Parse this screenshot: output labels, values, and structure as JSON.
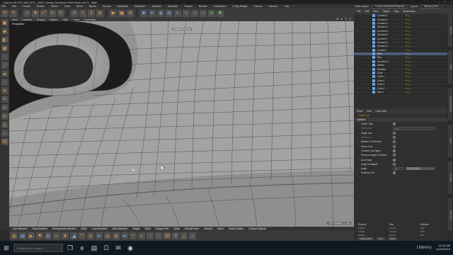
{
  "window": {
    "title": "Cinema 4D R21.026 (RC) - [2001 Harley-Davidson Street Bob.c4d *] - Main",
    "controls": [
      "–",
      "□",
      "×"
    ]
  },
  "menubar": [
    "File",
    "Edit",
    "Create",
    "Modes",
    "Select",
    "Tools",
    "Mesh",
    "Spline",
    "Volume",
    "MoGraph",
    "Character",
    "Animate",
    "Simulate",
    "Tracker",
    "Render",
    "Extensions",
    "X-Ray Bridge",
    "Corona",
    "Window",
    "Help"
  ],
  "layout": {
    "label": "Node Space:",
    "value": "Current (Standard/Physical)",
    "layout_label": "Layout:",
    "layout_value": "Startup (User)"
  },
  "toolbar_icons": [
    "undo-icon",
    "redo-icon",
    "live-selection-icon",
    "move-icon",
    "scale-icon",
    "rotate-icon",
    "recent-tools-icon",
    "x-axis-icon",
    "y-axis-icon",
    "z-axis-icon",
    "coordinate-system-icon",
    "render-view-icon",
    "render-picture-viewer-icon",
    "render-settings-icon",
    "cube-icon",
    "pen-icon",
    "subdivision-icon",
    "array-icon",
    "boole-icon",
    "sweep-icon",
    "deformer-icon",
    "floor-icon",
    "camera-icon",
    "light-icon"
  ],
  "viewport": {
    "menus": [
      "View",
      "Cameras",
      "Display",
      "Options",
      "Filter",
      "Panel",
      "ProRender"
    ],
    "label": "Perspective",
    "camera": "Default Camera",
    "grid_spacing": "Grid Spacing : 1 cm"
  },
  "bottom_selection": [
    "Live Selection",
    "Ring Selection",
    "Phong Break Selection",
    "Knife",
    "Loop Selection",
    "Path Selection",
    "Bridge",
    "Weld",
    "Polygon Pen",
    "Slide",
    "Extrude Inner",
    "Extrude",
    "Bevel",
    "Make Editable",
    "Connect Objects"
  ],
  "right_panel": {
    "tabs": [
      "File",
      "Edit",
      "View",
      "Object",
      "Tags",
      "Bookmarks"
    ],
    "objects": [
      {
        "name": "Connect.1",
        "selected": false
      },
      {
        "name": "Connect.2",
        "selected": false
      },
      {
        "name": "Connect.3",
        "selected": false
      },
      {
        "name": "Connect.4",
        "selected": false
      },
      {
        "name": "Connect.5",
        "selected": false
      },
      {
        "name": "Connect.6",
        "selected": false
      },
      {
        "name": "Connect.7",
        "selected": false
      },
      {
        "name": "Connect.8",
        "selected": false
      },
      {
        "name": "Connect.9",
        "selected": false
      },
      {
        "name": "Connect",
        "selected": false
      },
      {
        "name": "Tank",
        "selected": true
      },
      {
        "name": "Disc",
        "selected": false
      },
      {
        "name": "Connect.10",
        "selected": false
      },
      {
        "name": "Sweep",
        "selected": false
      },
      {
        "name": "Rotation",
        "selected": false
      },
      {
        "name": "Cube",
        "selected": false
      },
      {
        "name": "Cube.1",
        "selected": false
      },
      {
        "name": "Cube.2",
        "selected": false
      },
      {
        "name": "Cube.3",
        "selected": false
      },
      {
        "name": "Cube.4",
        "selected": false
      },
      {
        "name": "Disc.1",
        "selected": false
      }
    ],
    "vertical_tabs": [
      "Objects",
      "Takes",
      "Content Browser",
      "Layers",
      "Structure",
      "Attributes"
    ]
  },
  "attributes": {
    "tabs": [
      "Mode",
      "Edit",
      "User Data"
    ],
    "tool_title": "Line Cut",
    "section": "Options",
    "options": [
      {
        "label": "Visible Only",
        "type": "check",
        "checked": true,
        "dim": false
      },
      {
        "label": "Slice Mode",
        "type": "field",
        "value": "Cut",
        "dim": true
      },
      {
        "label": "Single Line",
        "type": "check",
        "checked": false,
        "dim": false
      },
      {
        "label": "Infinite Cut",
        "type": "check",
        "checked": false,
        "dim": true
      },
      {
        "label": "Restrict To Selection",
        "type": "check",
        "checked": false,
        "dim": false
      },
      {
        "label": "Select Cuts",
        "type": "check",
        "checked": false,
        "dim": false
      },
      {
        "label": "Connect Cut Edges",
        "type": "check",
        "checked": true,
        "dim": false
      },
      {
        "label": "Preserve Angle Curvature",
        "type": "check",
        "checked": false,
        "dim": false
      },
      {
        "label": "Auto Snap",
        "type": "check",
        "checked": true,
        "dim": false
      },
      {
        "label": "Angle Constraint",
        "type": "check",
        "checked": false,
        "dim": false
      },
      {
        "label": "Angle",
        "type": "slider",
        "value": "45 °",
        "fraction": 0.5,
        "dim": false
      },
      {
        "label": "Realtime Cut",
        "type": "check",
        "checked": true,
        "dim": false
      }
    ]
  },
  "coordinates": {
    "headers": [
      "Position",
      "Size",
      "Rotation"
    ],
    "rows": [
      [
        "X  0 cm",
        "X  1 cm",
        "H  0 °"
      ],
      [
        "Y  0 cm",
        "Y  1 cm",
        "P  0 °"
      ],
      [
        "Z  0 cm",
        "Z  1 cm",
        "B  0 °"
      ]
    ],
    "mode": "Object (Rel)",
    "size_mode": "Size",
    "apply": "Apply"
  },
  "taskbar": {
    "search_placeholder": "Type here to search",
    "time": "11:42 AM",
    "date": "14/11/2019"
  },
  "watermark": "Udemy",
  "colors": {
    "accent": "#e8a048",
    "selection": "#4b5d7a",
    "viewport": "#8a8a8a"
  }
}
